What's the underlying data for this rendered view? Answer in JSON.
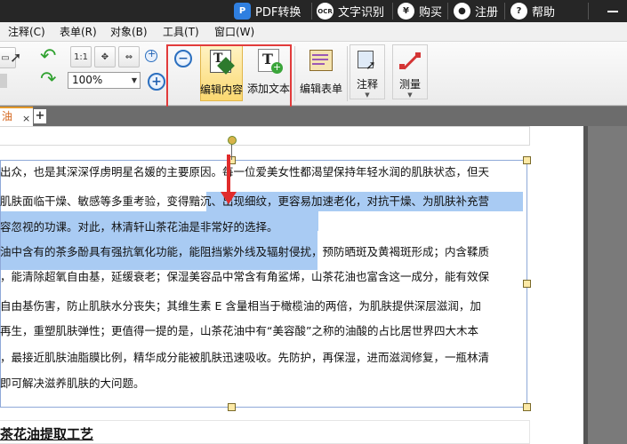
{
  "topbar": {
    "pdf_convert": "PDF转换",
    "ocr": "文字识别",
    "buy": "购买",
    "register": "注册",
    "help": "帮助",
    "ocr_badge": "OCR",
    "buy_badge": "¥",
    "help_badge": "?"
  },
  "menu": [
    "注释(C)",
    "表单(R)",
    "对象(B)",
    "工具(T)",
    "窗口(W)"
  ],
  "toolbar": {
    "zoom_value": "100%",
    "edit_content": "编辑内容",
    "add_text": "添加文本",
    "edit_form": "编辑表单",
    "annotate": "注释",
    "measure": "测量",
    "size_label": "1:1"
  },
  "tab": {
    "label": "油",
    "close": "×",
    "new": "+"
  },
  "document": {
    "lines": [
      "出众，也是其深深俘虏明星名媛的主要原因。每一位爱美女性都渴望保持年轻水润的肌肤状态，但天",
      "肌肤面临干燥、敏感等多重考验，变得黯沉、出现细纹，更容易加速老化，对抗干燥、为肌肤补充营",
      "容忽视的功课。对此，林清轩山茶花油是非常好的选择。",
      "油中含有的茶多酚具有强抗氧化功能，能阻挡紫外线及辐射侵扰，预防晒斑及黄褐斑形成；内含鞣质",
      "，能清除超氧自由基，延缓衰老；保湿美容品中常含有角鲨烯，山茶花油也富含这一成分，能有效保",
      "自由基伤害，防止肌肤水分丧失；其维生素 E 含量相当于橄榄油的两倍，为肌肤提供深层滋润，加",
      "再生，重塑肌肤弹性；更值得一提的是，山茶花油中有“美容酸”之称的油酸的占比居世界四大木本",
      "，最接近肌肤油脂膜比例，精华成分能被肌肤迅速吸收。先防护，再保湿，进而滋润修复，一瓶林清",
      "即可解决滋养肌肤的大问题。"
    ],
    "heading": "茶花油提取工艺"
  }
}
